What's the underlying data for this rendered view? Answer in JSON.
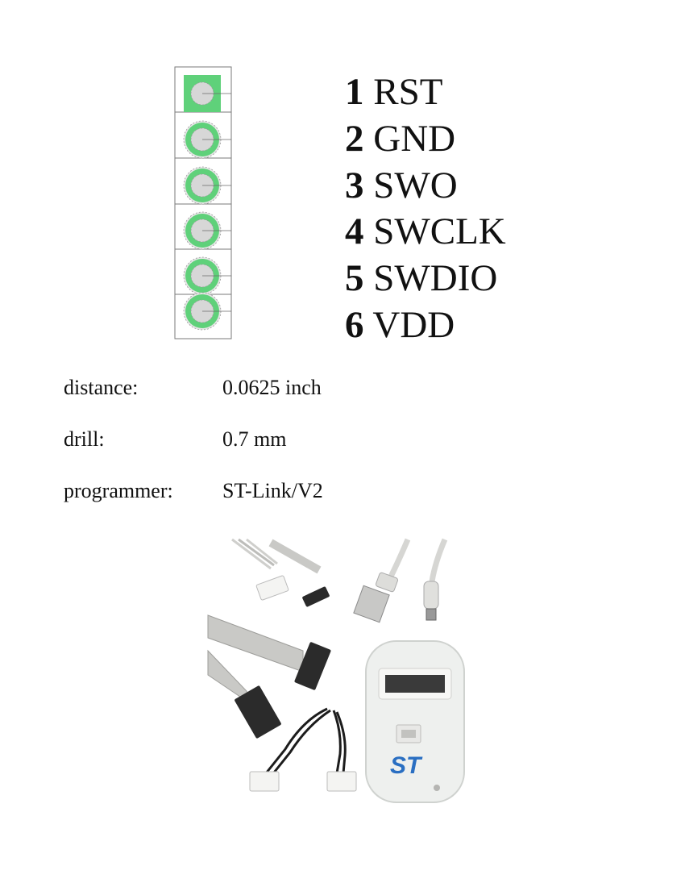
{
  "pins": [
    {
      "number": "1",
      "name": "RST"
    },
    {
      "number": "2",
      "name": "GND"
    },
    {
      "number": "3",
      "name": "SWO"
    },
    {
      "number": "4",
      "name": "SWCLK"
    },
    {
      "number": "5",
      "name": "SWDIO"
    },
    {
      "number": "6",
      "name": "VDD"
    }
  ],
  "specs": [
    {
      "label": "distance:",
      "value": "0.0625 inch"
    },
    {
      "label": "drill:",
      "value": "0.7 mm"
    },
    {
      "label": "programmer:",
      "value": "ST-Link/V2"
    }
  ],
  "photo": {
    "subject": "ST-Link/V2 programmer with cables",
    "logo_text": "ST"
  },
  "colors": {
    "pad_green": "#5fd17a",
    "drill_gray": "#d7d7d7",
    "outline": "#7a7a7a",
    "st_blue": "#2a6fc2",
    "device_white": "#eef0ee",
    "cable_gray": "#cfcfcc"
  }
}
